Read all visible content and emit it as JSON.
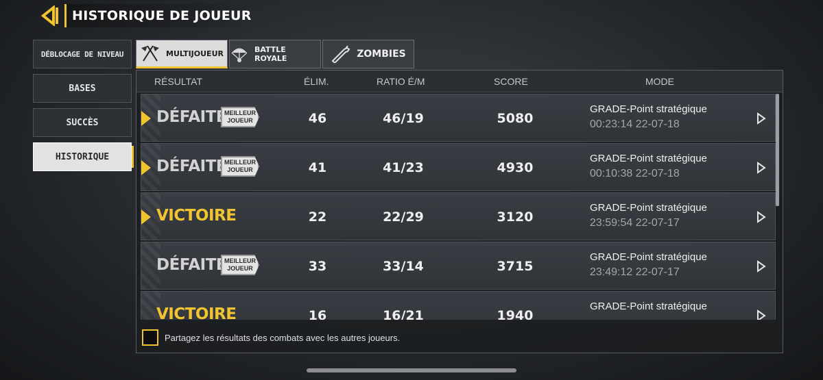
{
  "header": {
    "title": "HISTORIQUE DE JOUEUR"
  },
  "sidebar": {
    "items": [
      {
        "label": "DÉBLOCAGE DE NIVEAU"
      },
      {
        "label": "BASES"
      },
      {
        "label": "SUCCÈS"
      },
      {
        "label": "HISTORIQUE"
      }
    ],
    "active_index": 3
  },
  "tabs": [
    {
      "label": "MULTIJOUEUR",
      "icon": "crossed-flags-icon"
    },
    {
      "label": "BATTLE ROYALE",
      "icon": "parachute-icon"
    },
    {
      "label": "ZOMBIES",
      "icon": "zombie-arm-icon"
    }
  ],
  "columns": {
    "result": "RÉSULTAT",
    "elim": "ÉLIM.",
    "ratio": "RATIO É/M",
    "score": "SCORE",
    "mode": "MODE"
  },
  "badge": {
    "line1": "MEILLEUR",
    "line2": "JOUEUR"
  },
  "rows": [
    {
      "result": "DÉFAITE",
      "win": false,
      "mvp": true,
      "elim": "46",
      "ratio": "46/19",
      "score": "5080",
      "mode": "GRADE-Point stratégique",
      "time": "00:23:14 22-07-18"
    },
    {
      "result": "DÉFAITE",
      "win": false,
      "mvp": true,
      "elim": "41",
      "ratio": "41/23",
      "score": "4930",
      "mode": "GRADE-Point stratégique",
      "time": "00:10:38 22-07-18"
    },
    {
      "result": "VICTOIRE",
      "win": true,
      "mvp": false,
      "elim": "22",
      "ratio": "22/29",
      "score": "3120",
      "mode": "GRADE-Point stratégique",
      "time": "23:59:54 22-07-17"
    },
    {
      "result": "DÉFAITE",
      "win": false,
      "mvp": true,
      "elim": "33",
      "ratio": "33/14",
      "score": "3715",
      "mode": "GRADE-Point stratégique",
      "time": "23:49:12 22-07-17"
    },
    {
      "result": "VICTOIRE",
      "win": true,
      "mvp": false,
      "elim": "16",
      "ratio": "16/21",
      "score": "1940",
      "mode": "GRADE-Point stratégique",
      "time": ""
    }
  ],
  "footer": {
    "share_text": "Partagez les résultats des combats avec les autres joueurs."
  },
  "colors": {
    "accent": "#f0c431",
    "panel": "#1c1e21",
    "row": "#35383d"
  }
}
